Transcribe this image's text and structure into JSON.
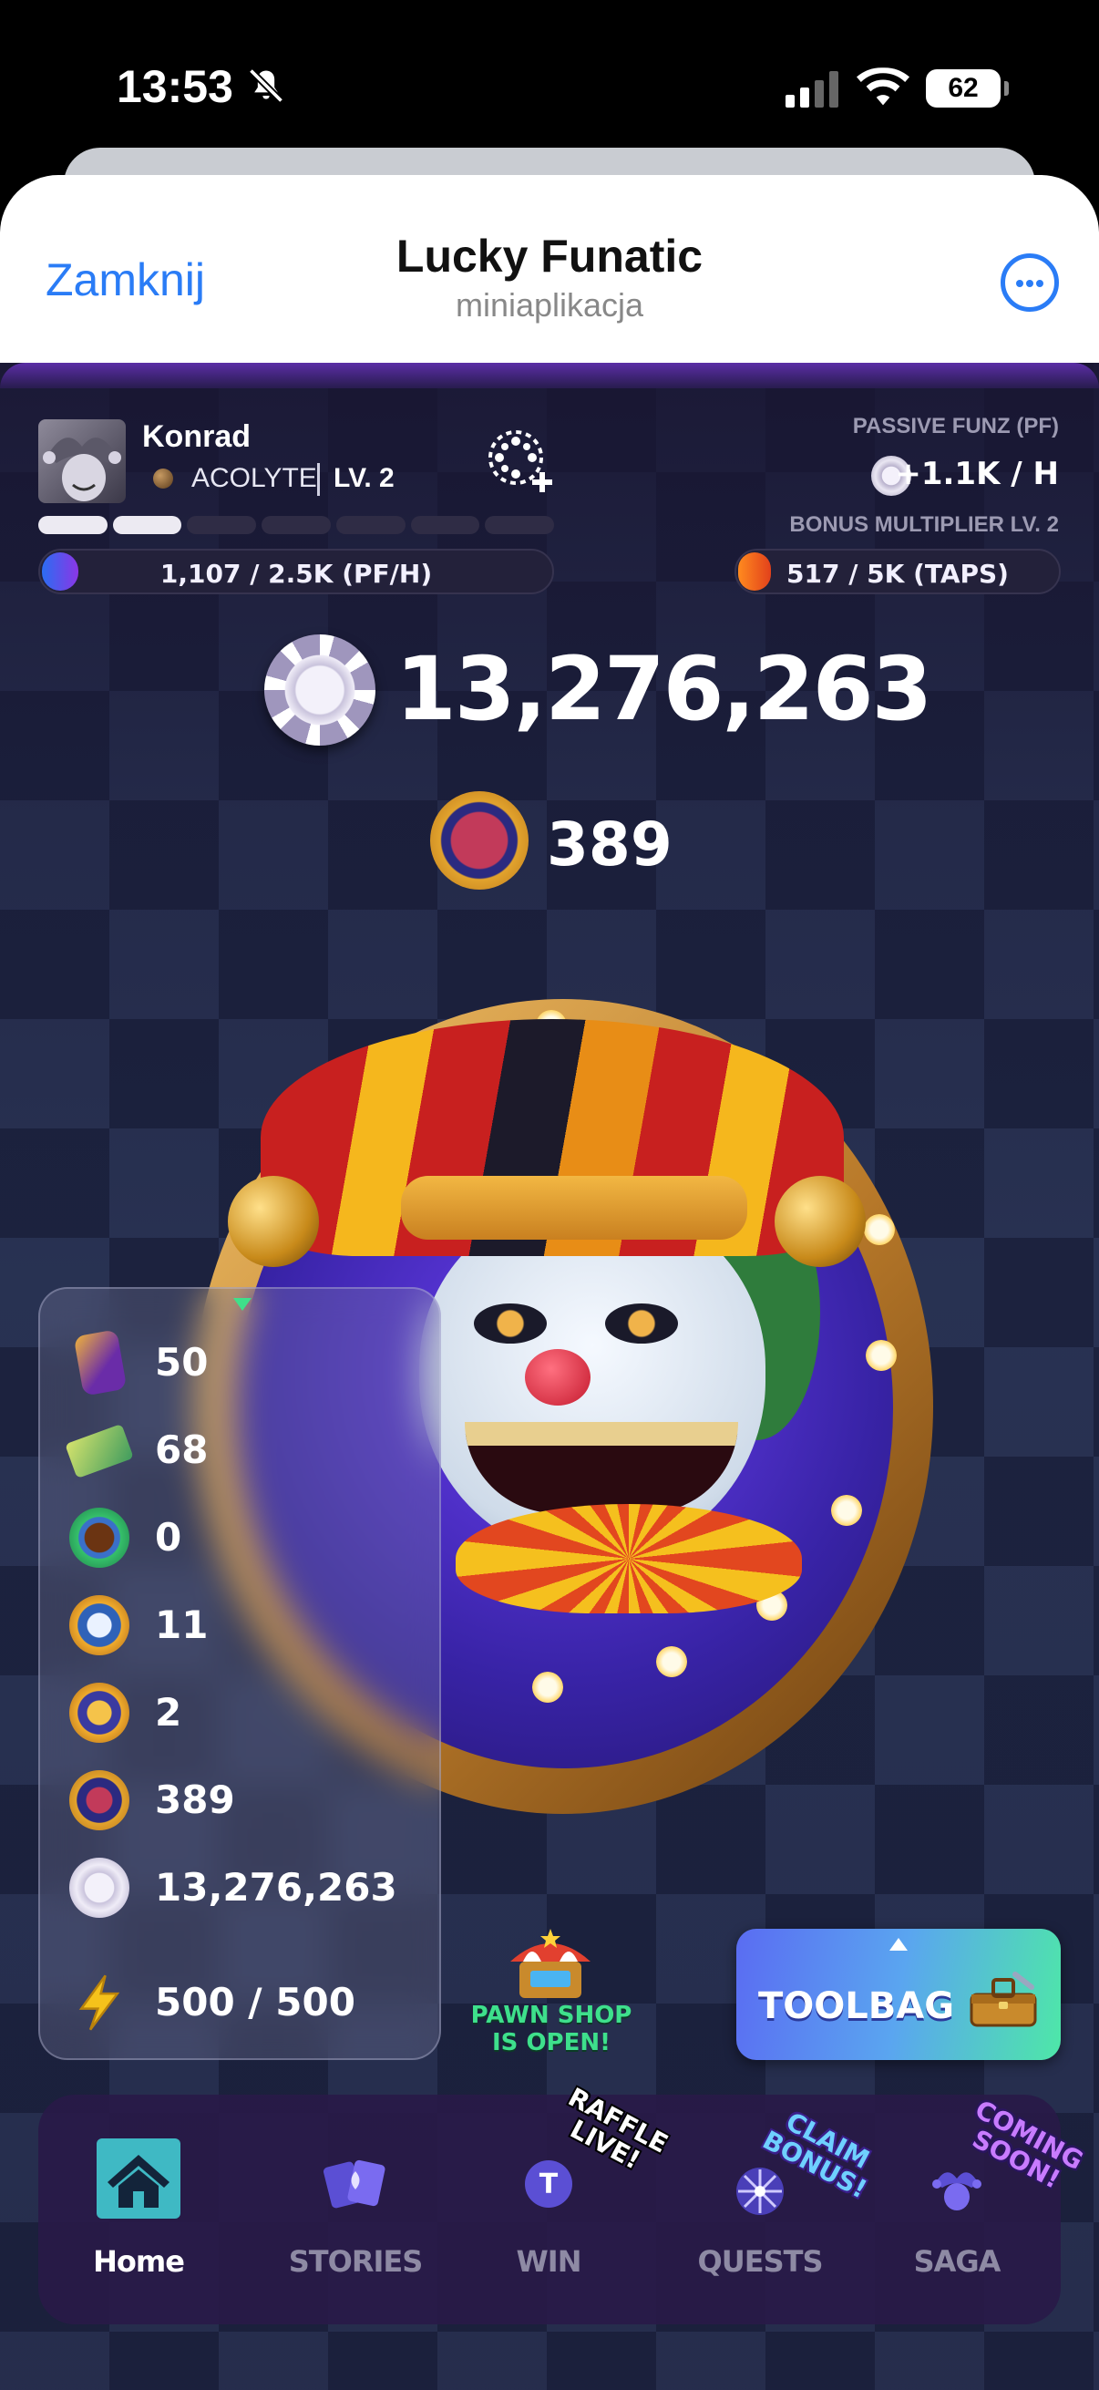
{
  "status_bar": {
    "time": "13:53",
    "battery": "62"
  },
  "header": {
    "close_label": "Zamknij",
    "title": "Lucky Funatic",
    "subtitle": "miniaplikacja"
  },
  "profile": {
    "username": "Konrad",
    "rank": "ACOLYTE",
    "level": "LV. 2",
    "level_segments_total": 7,
    "level_segments_filled": 2,
    "pf_bar_text": "1,107 / 2.5K (PF/H)",
    "pf_bar_progress": 0.44
  },
  "passive": {
    "label": "PASSIVE FUNZ (PF)",
    "value": "+1.1K / H",
    "bonus_label": "BONUS MULTIPLIER LV. 2",
    "taps_bar_text": "517 / 5K (TAPS)",
    "taps_bar_progress": 0.1
  },
  "balance": {
    "chips": "13,276,263",
    "tokens": "389"
  },
  "inventory": [
    {
      "icon": "card-icon",
      "value": "50"
    },
    {
      "icon": "ticket-icon",
      "value": "68"
    },
    {
      "icon": "coin-icon",
      "value": "0"
    },
    {
      "icon": "joker-token-icon",
      "value": "11"
    },
    {
      "icon": "golden-joker-token-icon",
      "value": "2"
    },
    {
      "icon": "jester-token-icon",
      "value": "389"
    },
    {
      "icon": "chip-icon",
      "value": "13,276,263"
    },
    {
      "icon": "energy-icon",
      "value": "500 / 500"
    }
  ],
  "pawn_shop": {
    "line1": "PAWN SHOP",
    "line2": "IS OPEN!"
  },
  "toolbag": {
    "label": "TOOLBAG"
  },
  "nav": [
    {
      "label": "Home",
      "icon": "home-icon",
      "active": true
    },
    {
      "label": "STORIES",
      "icon": "cards-icon",
      "active": false
    },
    {
      "label": "WIN",
      "icon": "ticket-coin-icon",
      "active": false
    },
    {
      "label": "QUESTS",
      "icon": "wheel-icon",
      "active": false
    },
    {
      "label": "SAGA",
      "icon": "jester-icon",
      "active": false
    }
  ],
  "stickers": {
    "raffle": "RAFFLE LIVE!",
    "claim": "CLAIM BONUS!",
    "soon": "COMING SOON!"
  },
  "colors": {
    "accent_blue": "#2a7cf6",
    "pawn_green": "#3ee08c",
    "toolbag_start": "#5a6cf2",
    "toolbag_end": "#4ee7a8"
  }
}
